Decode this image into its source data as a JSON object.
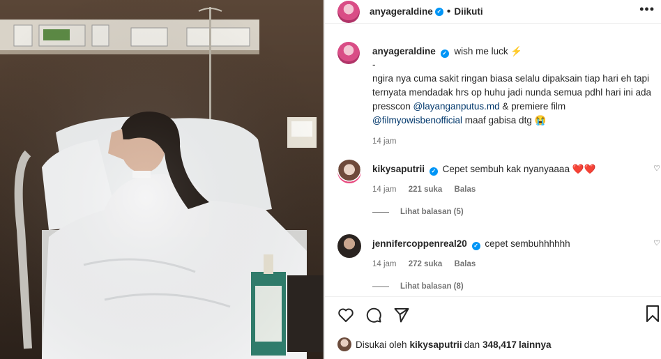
{
  "post": {
    "author": "anyageraldine",
    "follow_status": "Diikuti",
    "more_label": "•••",
    "caption_title": "wish me luck ⚡",
    "caption_dash": "-",
    "caption_body": "ngira nya cuma sakit ringan biasa selalu dipaksain tiap hari eh tapi ternyata mendadak hrs op huhu jadi nunda semua pdhl hari ini ada presscon",
    "mention_1": "@layanganputus.md",
    "caption_mid": " & premiere film ",
    "mention_2": "@filmyowisbenofficial",
    "caption_end": " maaf gabisa dtg 😭",
    "caption_time": "14 jam"
  },
  "comments": [
    {
      "username": "kikysaputrii",
      "text": "Cepet sembuh kak nyanyaaaa ❤️❤️",
      "time": "14 jam",
      "likes": "221 suka",
      "reply": "Balas",
      "view_replies": "Lihat balasan (5)"
    },
    {
      "username": "jennifercoppenreal20",
      "text": "cepet sembuhhhhhh",
      "time": "14 jam",
      "likes": "272 suka",
      "reply": "Balas",
      "view_replies": "Lihat balasan (8)"
    }
  ],
  "likes_bar": {
    "prefix": "Disukai oleh ",
    "user": "kikysaputrii",
    "mid": " dan ",
    "count": "348,417",
    "suffix": " lainnya"
  },
  "icons": [
    "heart-icon",
    "comment-icon",
    "share-icon",
    "bookmark-icon",
    "verified-icon"
  ],
  "colors": {
    "link": "#00376b",
    "verified": "#0095f6",
    "muted": "#737373"
  }
}
